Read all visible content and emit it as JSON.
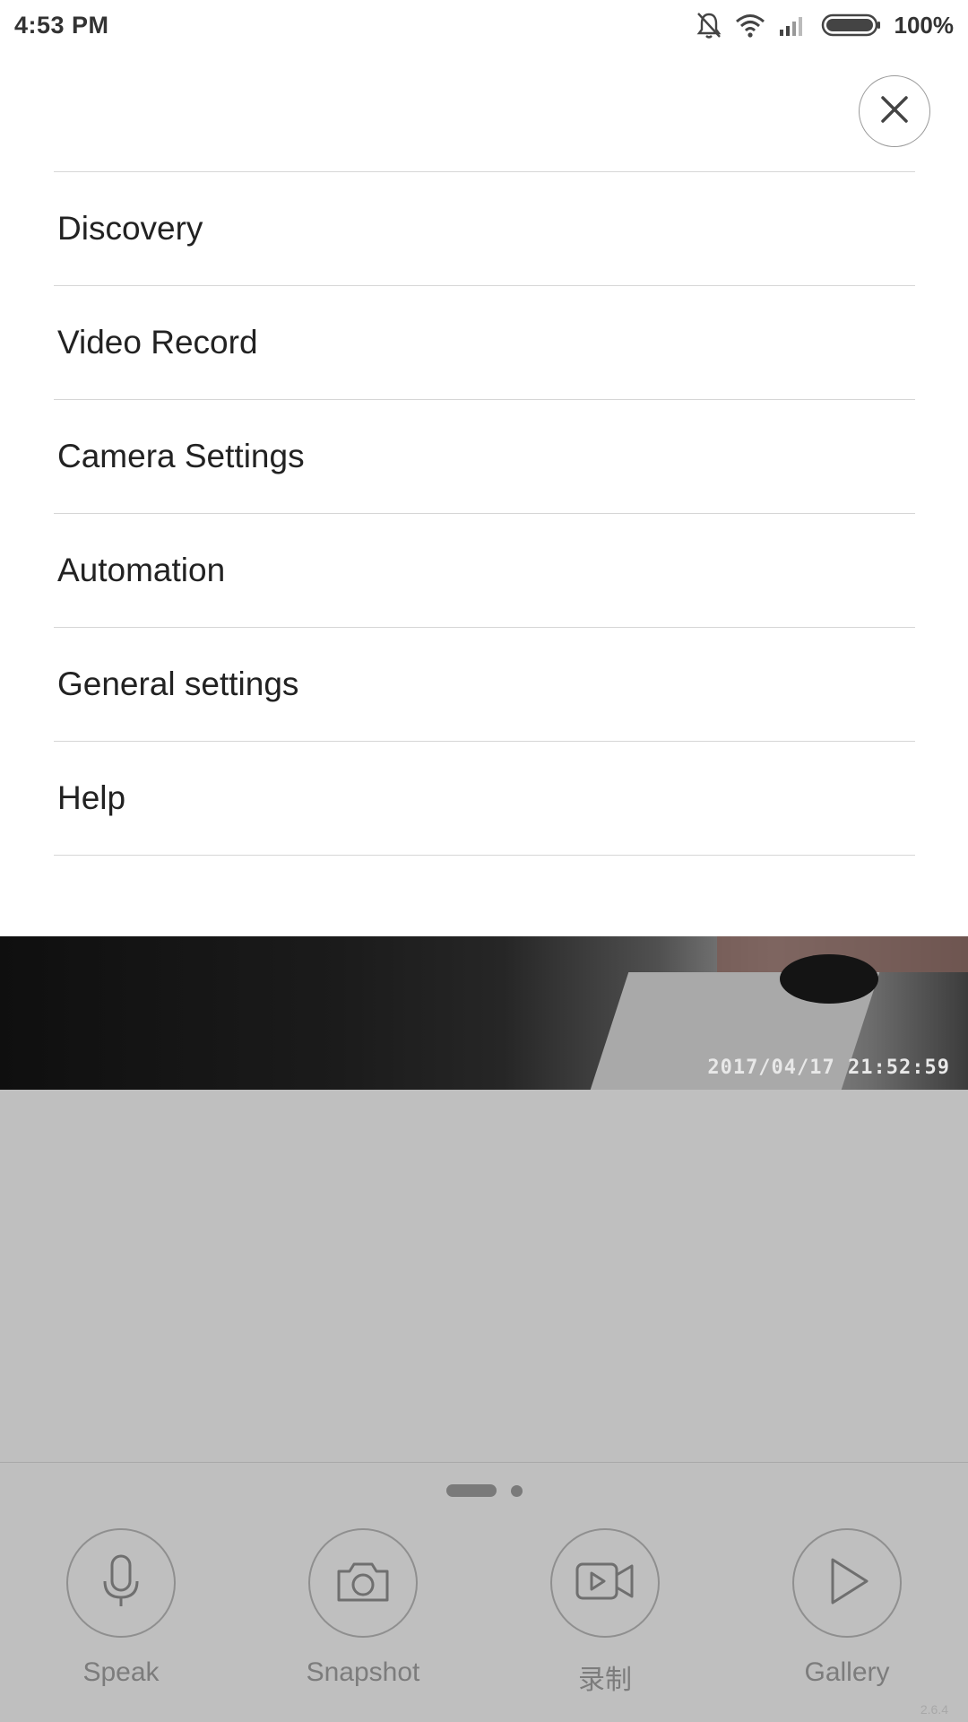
{
  "status_bar": {
    "time": "4:53 PM",
    "battery": "100%",
    "icons": [
      "bell-muted-icon",
      "wifi-icon",
      "signal-icon",
      "battery-icon"
    ]
  },
  "menu": {
    "close_icon": "close-icon",
    "items": [
      {
        "label": "Discovery"
      },
      {
        "label": "Video Record"
      },
      {
        "label": "Camera Settings"
      },
      {
        "label": "Automation"
      },
      {
        "label": "General settings"
      },
      {
        "label": "Help"
      }
    ]
  },
  "camera": {
    "timestamp": "2017/04/17 21:52:59"
  },
  "controls": [
    {
      "label": "Speak",
      "icon": "microphone-icon"
    },
    {
      "label": "Snapshot",
      "icon": "camera-icon"
    },
    {
      "label": "录制",
      "icon": "video-record-icon"
    },
    {
      "label": "Gallery",
      "icon": "play-icon"
    }
  ],
  "version": "2.6.4",
  "colors": {
    "panel": "#ffffff",
    "overlay": "#bfbfbf",
    "divider": "#d6d6d6",
    "control_text": "#7c7c7c"
  }
}
